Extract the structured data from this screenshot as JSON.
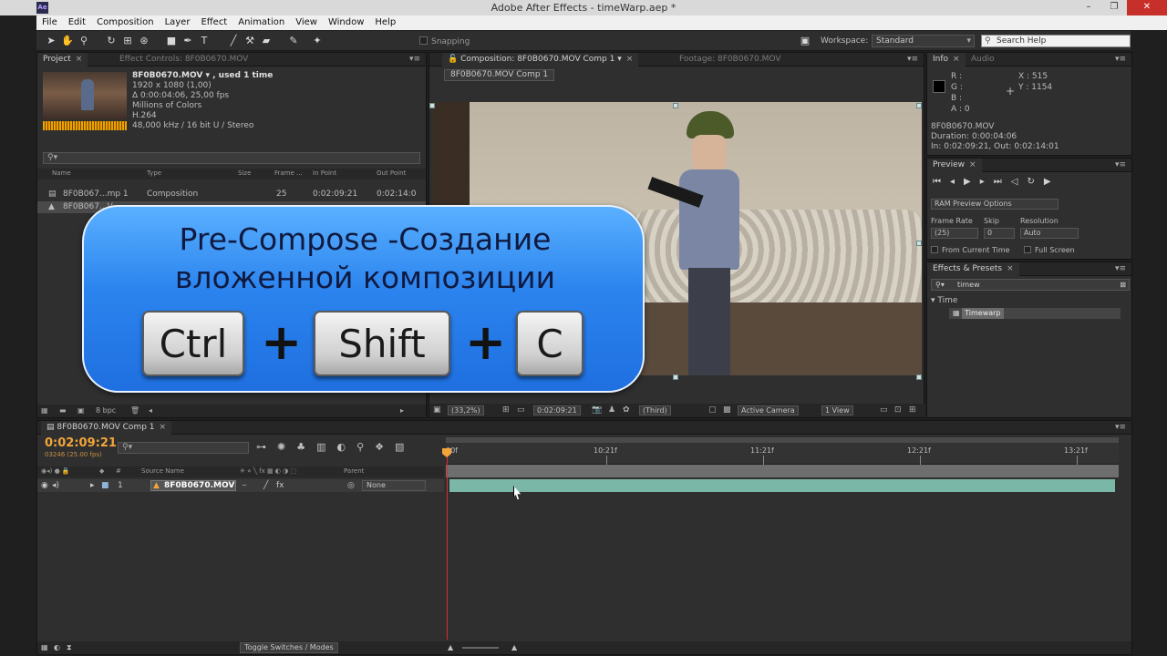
{
  "window": {
    "title": "Adobe After Effects - timeWarp.aep *",
    "app_icon": "Ae"
  },
  "menu": [
    "File",
    "Edit",
    "Composition",
    "Layer",
    "Effect",
    "Animation",
    "View",
    "Window",
    "Help"
  ],
  "toolbar": {
    "snapping_label": "Snapping",
    "workspace_label": "Workspace:",
    "workspace_value": "Standard",
    "search_help_placeholder": "Search Help"
  },
  "project_panel": {
    "tab_project": "Project",
    "tab_effect_controls": "Effect Controls: 8F0B0670.MOV",
    "file_title": "8F0B0670.MOV ▾ , used 1 time",
    "file_details": [
      "1920 x 1080 (1,00)",
      "Δ 0:00:04:06, 25,00 fps",
      "Millions of Colors",
      "H.264",
      "48,000 kHz / 16 bit U / Stereo"
    ],
    "search_placeholder": "",
    "columns": [
      "Name",
      "Type",
      "Size",
      "Frame ...",
      "In Point",
      "Out Point"
    ],
    "rows": [
      {
        "name": "8F0B067...mp 1",
        "type": "Composition",
        "frame": "25",
        "in": "0:02:09:21",
        "out": "0:02:14:0"
      },
      {
        "name": "8F0B067...V",
        "type": "",
        "frame": "",
        "in": "",
        "out": ""
      }
    ],
    "bpc": "8 bpc"
  },
  "composition_panel": {
    "tab_comp": "Composition: 8F0B0670.MOV Comp 1",
    "tab_footage": "Footage: 8F0B0670.MOV",
    "comp_name": "8F0B0670.MOV Comp 1",
    "zoom": "(33,2%)",
    "timecode": "0:02:09:21",
    "resolution": "(Third)",
    "camera": "Active Camera",
    "views": "1 View"
  },
  "info_panel": {
    "tab_info": "Info",
    "tab_audio": "Audio",
    "r_label": "R :",
    "g_label": "G :",
    "b_label": "B :",
    "a_label": "A : 0",
    "x": "X : 515",
    "y": "Y : 1154",
    "file": "8F0B0670.MOV",
    "duration": "Duration: 0:00:04:06",
    "in_out": "In: 0:02:09:21, Out: 0:02:14:01"
  },
  "preview_panel": {
    "tab": "Preview",
    "ram_options": "RAM Preview Options",
    "frame_rate_label": "Frame Rate",
    "frame_rate_value": "(25)",
    "skip_label": "Skip",
    "skip_value": "0",
    "resolution_label": "Resolution",
    "resolution_value": "Auto",
    "from_current_time": "From Current Time",
    "full_screen": "Full Screen"
  },
  "effects_panel": {
    "tab": "Effects & Presets",
    "search_value": "timew",
    "category": "▾ Time",
    "item": "Timewarp"
  },
  "timeline": {
    "tab": "8F0B0670.MOV Comp 1",
    "current_time": "0:02:09:21",
    "frame_info": "03246 (25.00 fps)",
    "ruler_ticks": [
      "00f",
      "10:21f",
      "11:21f",
      "12:21f",
      "13:21f"
    ],
    "col_source": "Source Name",
    "col_parent": "Parent",
    "layer": {
      "index": "1",
      "name": "8F0B0670.MOV",
      "parent": "None"
    },
    "toggle_label": "Toggle Switches / Modes"
  },
  "callout": {
    "line1": "Pre-Compose -Создание",
    "line2": "вложенной композиции",
    "key1": "Ctrl",
    "plus": "+",
    "key2": "Shift",
    "key3": "C"
  }
}
